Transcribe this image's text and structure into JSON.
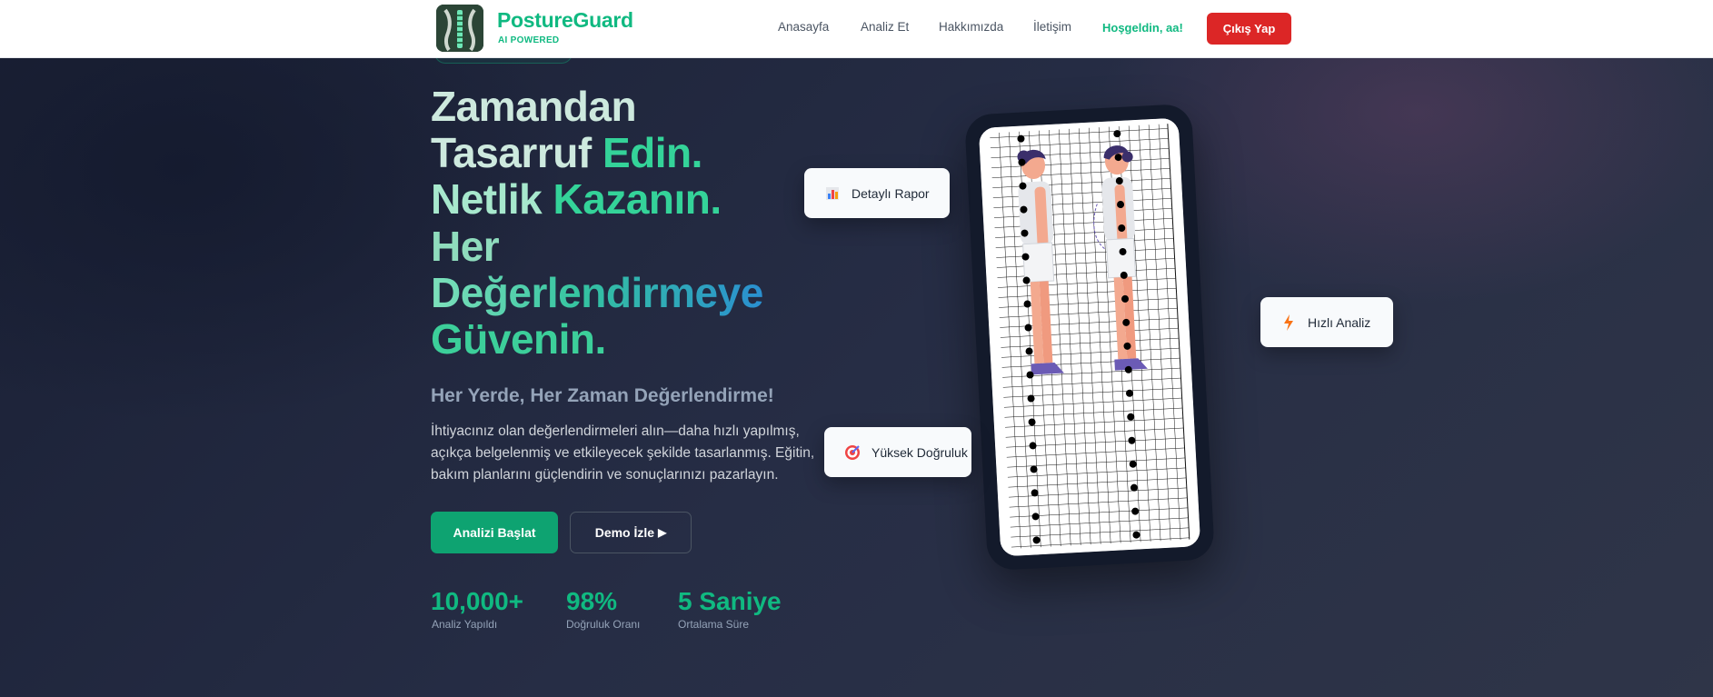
{
  "brand": {
    "title": "PostureGuard",
    "subtitle": "AI POWERED"
  },
  "nav": {
    "links": [
      "Anasayfa",
      "Analiz Et",
      "Hakkımızda",
      "İletişim"
    ],
    "welcome": "Hoşgeldin, aa!",
    "logout": "Çıkış Yap"
  },
  "hero": {
    "line1": "Zamandan",
    "line2a": "Tasarruf ",
    "line2b": "Edin.",
    "line3a": "Netlik ",
    "line3b": "Kazanın.",
    "line4": "Her",
    "line5": "Değerlendirmeye",
    "line6": "Güvenin.",
    "subheading": "Her Yerde, Her Zaman Değerlendirme!",
    "description": "İhtiyacınız olan değerlendirmeleri alın—daha hızlı yapılmış, açıkça belgelenmiş ve etkileyecek şekilde tasarlanmış. Eğitin, bakım planlarını güçlendirin ve sonuçlarınızı pazarlayın.",
    "primary_button": "Analizi Başlat",
    "secondary_button": "Demo İzle",
    "secondary_icon": "play-icon"
  },
  "stats": [
    {
      "value": "10,000+",
      "label": "Analiz Yapıldı"
    },
    {
      "value": "98%",
      "label": "Doğruluk Oranı"
    },
    {
      "value": "5 Saniye",
      "label": "Ortalama Süre"
    }
  ],
  "features": [
    {
      "label": "Detaylı Rapor",
      "icon": "bar-chart-icon"
    },
    {
      "label": "Hızlı Analiz",
      "icon": "lightning-icon"
    },
    {
      "label": "Yüksek Doğruluk",
      "icon": "target-icon"
    }
  ],
  "colors": {
    "accent": "#10b981",
    "danger": "#dc2626",
    "background": "#222a3e"
  }
}
